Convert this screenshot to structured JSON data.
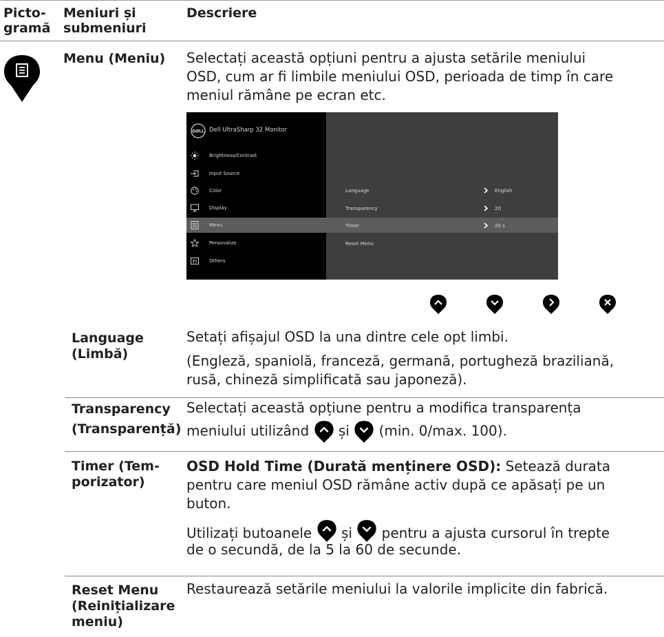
{
  "header": {
    "col1": [
      "Picto-",
      "gramă"
    ],
    "col2": [
      "Meniuri și",
      "submeniuri"
    ],
    "col3": "Descriere"
  },
  "menu": {
    "name": "Menu (Meniu)",
    "desc": [
      "Selectați această opțiuni pentru a ajusta setările meniului",
      "OSD, cum ar fi limbile meniului OSD, perioada de timp în care",
      "meniul rămâne pe ecran etc."
    ],
    "icon": "menu-list-icon"
  },
  "osd": {
    "brand": "DELL",
    "title": "Dell UltraSharp 32 Monitor",
    "items": [
      "Brightness/Contrast",
      "Input Source",
      "Color",
      "Display",
      "Menu",
      "Personalize",
      "Others"
    ],
    "options": [
      {
        "label": "Language",
        "value": "English"
      },
      {
        "label": "Transparency",
        "value": "20"
      },
      {
        "label": "Timer",
        "value": "20 s"
      },
      {
        "label": "Reset Menu",
        "value": ""
      }
    ],
    "highlight_color": "#5c5c5c"
  },
  "nav_buttons": [
    "up-icon",
    "down-icon",
    "right-icon",
    "close-icon"
  ],
  "rows": {
    "language": {
      "name": [
        "Language",
        "(Limbă)"
      ],
      "desc1": "Setați afișajul OSD la una dintre cele opt limbi.",
      "desc2": [
        "(Engleză, spaniolă, franceză, germană, portugheză braziliană,",
        "rusă, chineză simplificată sau japoneză)."
      ]
    },
    "transparency": {
      "name": [
        "Transparency",
        "(Transparență)"
      ],
      "desc1": "Selectați această opțiune pentru a modifica transparența",
      "desc2a": "meniului utilizând",
      "desc2b": "și",
      "desc2c": "(min. 0/max. 100)."
    },
    "timer": {
      "name": [
        "Timer (Tem-",
        "porizator)"
      ],
      "bold": "OSD Hold Time (Durată menținere OSD):",
      "rest1": " Setează durata",
      "rest2": [
        "pentru care meniul OSD rămâne activ după ce apăsați pe un",
        "buton."
      ],
      "p2a": "Utilizați butoanele",
      "p2b": "și",
      "p2c": "pentru a ajusta cursorul în trepte",
      "p2d": "de o secundă, de la 5 la 60 de secunde."
    },
    "reset": {
      "name": [
        "Reset Menu",
        "(Reinițializare",
        "meniu)"
      ],
      "desc": "Restaurează setările meniului la valorile implicite din fabrică."
    }
  }
}
